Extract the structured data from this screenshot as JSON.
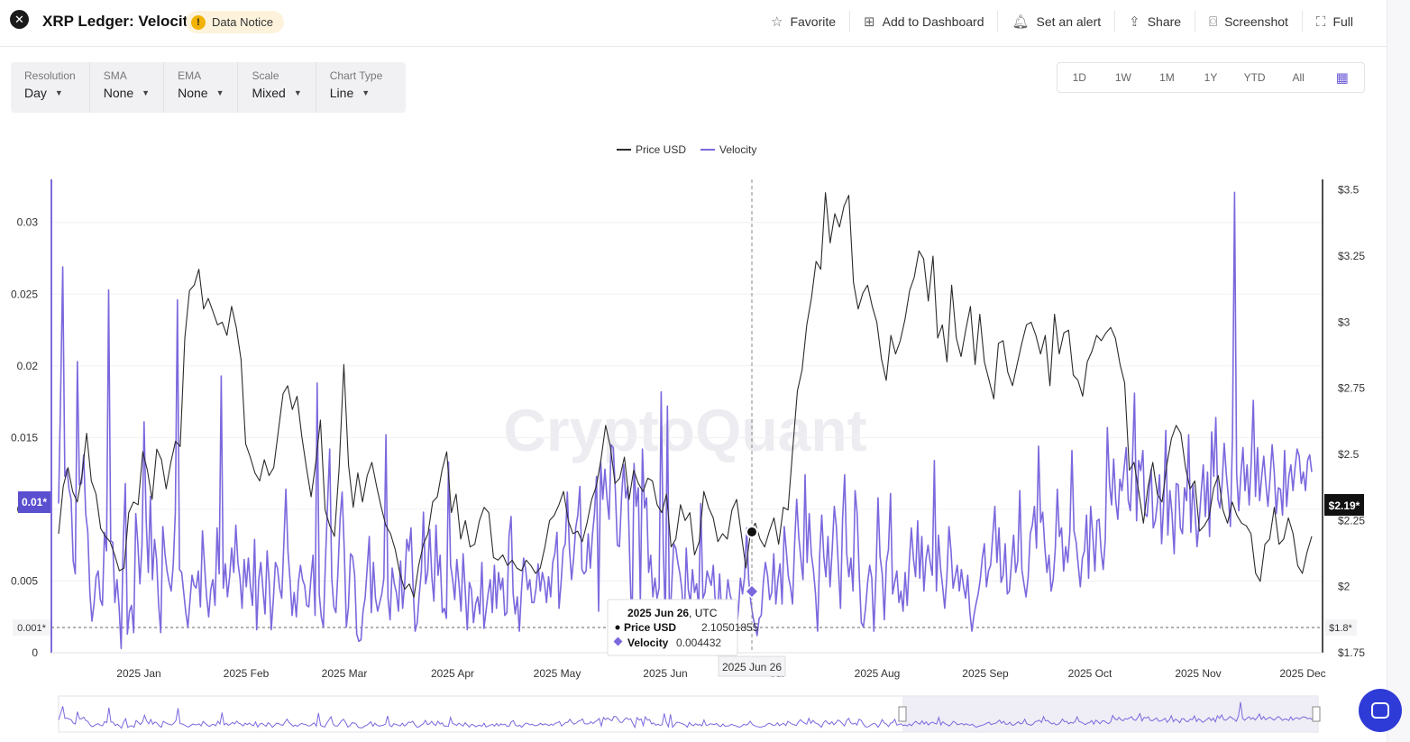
{
  "header": {
    "close_label": "✕",
    "title": "XRP Ledger: Velocity",
    "notice_icon": "!",
    "notice_label": "Data Notice",
    "actions": [
      {
        "label": "Favorite",
        "icon": "star-icon",
        "glyph": "☆"
      },
      {
        "label": "Add to Dashboard",
        "icon": "dashboard-add-icon",
        "glyph": "⊞"
      },
      {
        "label": "Set an alert",
        "icon": "bell-icon",
        "glyph": "🔔︎"
      },
      {
        "label": "Share",
        "icon": "share-icon",
        "glyph": "⇪"
      },
      {
        "label": "Screenshot",
        "icon": "camera-icon",
        "glyph": "⌼"
      },
      {
        "label": "Full",
        "icon": "fullscreen-icon",
        "glyph": "⛶"
      }
    ]
  },
  "toolbar": [
    {
      "label": "Resolution",
      "value": "Day"
    },
    {
      "label": "SMA",
      "value": "None"
    },
    {
      "label": "EMA",
      "value": "None"
    },
    {
      "label": "Scale",
      "value": "Mixed"
    },
    {
      "label": "Chart Type",
      "value": "Line"
    }
  ],
  "ranges": [
    "1D",
    "1W",
    "1M",
    "1Y",
    "YTD",
    "All"
  ],
  "calendar_icon": "calendar-icon",
  "colors": {
    "price": "#2b2b2b",
    "velocity": "#7b68dd",
    "accent": "#5a4fcf"
  },
  "watermark": "CryptoQuant",
  "tooltip": {
    "date": "2025 Jun 26",
    "date_suffix": ", UTC",
    "price_label": "Price USD",
    "price_value": "2.10501855",
    "velocity_label": "Velocity",
    "velocity_value": "0.004432"
  },
  "crosshair_label": "2025 Jun 26",
  "left_badge": "0.01*",
  "left_min_label": "0.001*",
  "right_badge": "$2.19*",
  "right_min_label": "$1.8*",
  "chart_data": {
    "type": "line",
    "legend": [
      "Price USD",
      "Velocity"
    ],
    "legend_position": "top-center",
    "x_ticks": [
      "2025 Jan",
      "2025 Feb",
      "2025 Mar",
      "2025 Apr",
      "2025 May",
      "2025 Jun",
      "Jul",
      "2025 Aug",
      "2025 Sep",
      "2025 Oct",
      "2025 Nov",
      "2025 Dec"
    ],
    "y_left_ticks": [
      "0",
      "0.005",
      "0.01",
      "0.015",
      "0.02",
      "0.025",
      "0.03"
    ],
    "y_left_range": [
      0,
      0.033
    ],
    "y_right_ticks": [
      "$1.75",
      "$2",
      "$2.25",
      "$2.5",
      "$2.75",
      "$3",
      "$3.25",
      "$3.5"
    ],
    "y_right_range": [
      1.75,
      3.54
    ],
    "grid": true,
    "series": [
      {
        "name": "Price USD",
        "axis": "right",
        "values": [
          2.2,
          2.38,
          2.45,
          2.36,
          2.32,
          2.42,
          2.58,
          2.4,
          2.35,
          2.22,
          2.19,
          2.17,
          2.12,
          2.06,
          2.07,
          2.28,
          2.32,
          2.31,
          2.51,
          2.44,
          2.33,
          2.52,
          2.48,
          2.37,
          2.47,
          2.55,
          2.53,
          2.94,
          3.12,
          3.14,
          3.2,
          3.05,
          3.09,
          3.04,
          2.99,
          3,
          2.95,
          3.06,
          2.98,
          2.86,
          2.54,
          2.49,
          2.43,
          2.4,
          2.48,
          2.42,
          2.45,
          2.59,
          2.73,
          2.76,
          2.67,
          2.72,
          2.57,
          2.45,
          2.34,
          2.47,
          2.63,
          2.29,
          2.23,
          2.19,
          2.45,
          2.84,
          2.46,
          2.3,
          2.43,
          2.32,
          2.42,
          2.47,
          2.38,
          2.3,
          2.23,
          2.2,
          2.14,
          2.05,
          1.99,
          2.01,
          1.96,
          2.08,
          2.16,
          2.2,
          2.32,
          2.34,
          2.44,
          2.51,
          2.28,
          2.35,
          2.18,
          2.25,
          2.15,
          2.16,
          2.25,
          2.3,
          2.28,
          2.11,
          2.1,
          2.12,
          2.08,
          2.1,
          2.07,
          2.06,
          2.1,
          2.08,
          2.05,
          2.07,
          2.15,
          2.25,
          2.27,
          2.31,
          2.36,
          2.25,
          2.2,
          2.21,
          2.17,
          2.24,
          2.33,
          2.38,
          2.48,
          2.61,
          2.53,
          2.39,
          2.41,
          2.49,
          2.33,
          2.44,
          2.39,
          2.36,
          2.41,
          2.4,
          2.31,
          2.28,
          2.35,
          2.15,
          2.18,
          2.31,
          2.25,
          2.28,
          2.12,
          2.17,
          2.36,
          2.3,
          2.26,
          2.17,
          2.2,
          2.18,
          2.29,
          2.33,
          2.2,
          2.07,
          2.21,
          2.24,
          2.18,
          2.15,
          2.21,
          2.26,
          2.16,
          2.3,
          2.29,
          2.52,
          2.74,
          2.82,
          2.99,
          3.09,
          3.23,
          3.2,
          3.49,
          3.3,
          3.41,
          3.36,
          3.44,
          3.48,
          3.15,
          3.05,
          3.11,
          3.14,
          3.06,
          3,
          2.86,
          2.78,
          2.95,
          2.88,
          2.93,
          3.01,
          3.12,
          3.17,
          3.27,
          3.24,
          3.08,
          3.25,
          2.94,
          2.99,
          2.85,
          3.14,
          2.94,
          2.87,
          2.97,
          3.06,
          2.84,
          3.03,
          2.85,
          2.78,
          2.71,
          2.92,
          2.93,
          2.81,
          2.76,
          2.84,
          2.92,
          2.99,
          3,
          2.95,
          2.88,
          2.95,
          2.76,
          3.03,
          2.88,
          2.96,
          2.97,
          2.8,
          2.78,
          2.72,
          2.85,
          2.89,
          2.95,
          2.93,
          2.96,
          2.98,
          2.94,
          2.84,
          2.77,
          2.44,
          2.47,
          2.36,
          2.24,
          2.38,
          2.47,
          2.35,
          2.32,
          2.46,
          2.56,
          2.61,
          2.58,
          2.45,
          2.37,
          2.4,
          2.21,
          2.23,
          2.26,
          2.37,
          2.42,
          2.29,
          2.24,
          2.32,
          2.27,
          2.24,
          2.23,
          2.2,
          2.05,
          2.02,
          2.16,
          2.18,
          2.3,
          2.16,
          2.18,
          2.26,
          2.2,
          2.08,
          2.05,
          2.13,
          2.19
        ]
      },
      {
        "name": "Velocity",
        "axis": "left",
        "values": [
          0.0104,
          0.0182,
          0.0269,
          0.0123,
          0.0128,
          0.0114,
          0.0107,
          0.0064,
          0.0055,
          0.0203,
          0.0117,
          0.0118,
          0.0138,
          0.0097,
          0.0084,
          0.0042,
          0.0022,
          0.0034,
          0.0053,
          0.0057,
          0.0037,
          0.0033,
          0.0084,
          0.0071,
          0.0253,
          0.0078,
          0.0077,
          0.0035,
          0.0051,
          0.0032,
          0.0003,
          0.0077,
          0.0118,
          0.0013,
          0.0029,
          0.0033,
          0.0014,
          0.0097,
          0.0076,
          0.0048,
          0.0075,
          0.0161,
          0.0093,
          0.0056,
          0.0109,
          0.0051,
          0.0079,
          0.0065,
          0.0033,
          0.0014,
          0.0088,
          0.0069,
          0.0057,
          0.0049,
          0.0043,
          0.0062,
          0.0098,
          0.0246,
          0.0058,
          0.0056,
          0.0042,
          0.0028,
          0.0018,
          0.0036,
          0.0054,
          0.0047,
          0.0045,
          0.0057,
          0.0032,
          0.0085,
          0.0061,
          0.0039,
          0.0025,
          0.0044,
          0.0051,
          0.0033,
          0.0087,
          0.0055,
          0.0193,
          0.0045,
          0.0062,
          0.0039,
          0.0053,
          0.0073,
          0.0056,
          0.0089,
          0.0063,
          0.0052,
          0.0031,
          0.0065,
          0.0046,
          0.0066,
          0.0046,
          0.0033,
          0.0079,
          0.0016,
          0.0051,
          0.0063,
          0.0044,
          0.0027,
          0.0071,
          0.0049,
          0.0016,
          0.0037,
          0.0063,
          0.0059,
          0.0045,
          0.0038,
          0.0075,
          0.0114,
          0.0071,
          0.0051,
          0.0026,
          0.0042,
          0.0025,
          0.0049,
          0.0061,
          0.0051,
          0.0047,
          0.0033,
          0.0032,
          0.0052,
          0.0068,
          0.0026,
          0.0188,
          0.0041,
          0.0025,
          0.0018,
          0.0064,
          0.0105,
          0.0142,
          0.0052,
          0.0032,
          0.0028,
          0.0057,
          0.0093,
          0.0112,
          0.0071,
          0.0018,
          0.0032,
          0.0069,
          0.0067,
          0.0054,
          0.0013,
          0.0008,
          0.0009,
          0.0029,
          0.0038,
          0.0059,
          0.0081,
          0.0028,
          0.0063,
          0.0038,
          0.0029,
          0.0035,
          0.0041,
          0.0052,
          0.0152,
          0.0038,
          0.0023,
          0.0059,
          0.0048,
          0.0042,
          0.0029,
          0.0064,
          0.0031,
          0.0048,
          0.0079,
          0.0071,
          0.0087,
          0.0046,
          0.0015,
          0.0021,
          0.0041,
          0.0057,
          0.0098,
          0.0048,
          0.0056,
          0.0086,
          0.0053,
          0.0036,
          0.0089,
          0.0054,
          0.0068,
          0.0028,
          0.0031,
          0.0024,
          0.0133,
          0.0061,
          0.0051,
          0.0037,
          0.0065,
          0.0048,
          0.0029,
          0.0069,
          0.0044,
          0.0016,
          0.0049,
          0.0044,
          0.0021,
          0.0034,
          0.0039,
          0.0027,
          0.0063,
          0.0017,
          0.0029,
          0.0041,
          0.0051,
          0.0028,
          0.0061,
          0.0031,
          0.0056,
          0.0044,
          0.0052,
          0.0026,
          0.0028,
          0.0081,
          0.0095,
          0.0041,
          0.0027,
          0.0039,
          0.0015,
          0.0043,
          0.0066,
          0.0058,
          0.0044,
          0.0051,
          0.0035,
          0.0035,
          0.0045,
          0.0062,
          0.0043,
          0.0056,
          0.0049,
          0.0035,
          0.0053,
          0.0039,
          0.0063,
          0.0069,
          0.0084,
          0.0031,
          0.0049,
          0.0072,
          0.0076,
          0.0112,
          0.0073,
          0.0051,
          0.0066,
          0.0087,
          0.0096,
          0.0116,
          0.0058,
          0.0055,
          0.0057,
          0.0083,
          0.0059,
          0.0082,
          0.0097,
          0.0123,
          0.0029,
          0.0133,
          0.0107,
          0.0128,
          0.0108,
          0.0093,
          0.0145,
          0.0143,
          0.0114,
          0.0075,
          0.0074,
          0.0109,
          0.0131,
          0.0108,
          0.0116,
          0.0061,
          0.0013,
          0.0132,
          0.0102,
          0.0115,
          0.0035,
          0.0142,
          0.0101,
          0.0108,
          0.0056,
          0.0068,
          0.0039,
          0.0052,
          0.0038,
          0.0045,
          0.0182,
          0.0074,
          0.0021,
          0.0172,
          0.0015,
          0.0046,
          0.0076,
          0.0073,
          0.0063,
          0.0055,
          0.0043,
          0.0015,
          0.0073,
          0.0044,
          0.0035,
          0.0058,
          0.0042,
          0.0048,
          0.0031,
          0.0104,
          0.0038,
          0.0042,
          0.0057,
          0.0052,
          0.0047,
          0.0061,
          0.0034,
          0.0024,
          0.0055,
          0.0027,
          0.0029,
          0.0033,
          0.0051,
          0.0041,
          0.0035,
          0.0022,
          0.0016,
          0.0029,
          0.0052,
          0.0041,
          0.0053,
          0.0087,
          0.0051,
          0.0035,
          0.0025,
          0.0019,
          0.0012,
          0.0024,
          0.0026,
          0.0049,
          0.0063,
          0.0054,
          0.0037,
          0.0042,
          0.0069,
          0.0034,
          0.0051,
          0.0062,
          0.0034,
          0.0088,
          0.0071,
          0.0053,
          0.0046,
          0.0034,
          0.0076,
          0.0107,
          0.0081,
          0.0065,
          0.0051,
          0.0124,
          0.0063,
          0.0097,
          0.0069,
          0.0058,
          0.0041,
          0.0015,
          0.0068,
          0.0096,
          0.0067,
          0.0053,
          0.0081,
          0.0046,
          0.0072,
          0.0102,
          0.0088,
          0.0059,
          0.0031,
          0.0093,
          0.0124,
          0.0069,
          0.0053,
          0.0066,
          0.0043,
          0.0113,
          0.0097,
          0.0054,
          0.0021,
          0.0018,
          0.0031,
          0.0049,
          0.0061,
          0.0052,
          0.0015,
          0.0053,
          0.0108,
          0.0067,
          0.0055,
          0.0023,
          0.0063,
          0.0072,
          0.0111,
          0.0041,
          0.0049,
          0.0057,
          0.0035,
          0.0043,
          0.0029,
          0.0056,
          0.0033,
          0.0063,
          0.0087,
          0.0065,
          0.0053,
          0.0092,
          0.0052,
          0.0081,
          0.0043,
          0.0065,
          0.0075,
          0.0063,
          0.0054,
          0.0134,
          0.0043,
          0.0082,
          0.0059,
          0.0046,
          0.0031,
          0.0053,
          0.0088,
          0.0071,
          0.0045,
          0.0053,
          0.0061,
          0.0043,
          0.0058,
          0.0046,
          0.0038,
          0.0054,
          0.0029,
          0.0015,
          0.0026,
          0.0034,
          0.0041,
          0.0051,
          0.0066,
          0.0076,
          0.0046,
          0.0057,
          0.0061,
          0.0081,
          0.0102,
          0.0063,
          0.0087,
          0.0049,
          0.0054,
          0.0076,
          0.0041,
          0.0043,
          0.0063,
          0.0082,
          0.0056,
          0.0064,
          0.0113,
          0.0058,
          0.0048,
          0.0039,
          0.0053,
          0.0083,
          0.0089,
          0.0102,
          0.0073,
          0.0144,
          0.0091,
          0.0098,
          0.0073,
          0.0056,
          0.0068,
          0.0043,
          0.0051,
          0.0072,
          0.0114,
          0.0081,
          0.0087,
          0.0057,
          0.0074,
          0.0063,
          0.0084,
          0.0141,
          0.0085,
          0.0077,
          0.0061,
          0.0046,
          0.0066,
          0.0071,
          0.0096,
          0.0052,
          0.0102,
          0.0081,
          0.0057,
          0.0092,
          0.0093,
          0.0071,
          0.0058,
          0.0079,
          0.0157,
          0.0118,
          0.0103,
          0.0135,
          0.0106,
          0.0093,
          0.0121,
          0.0113,
          0.0128,
          0.0143,
          0.0106,
          0.0099,
          0.0133,
          0.0181,
          0.0092,
          0.0134,
          0.0127,
          0.0141,
          0.0097,
          0.0095,
          0.0113,
          0.0128,
          0.0087,
          0.0092,
          0.0105,
          0.0124,
          0.0076,
          0.0104,
          0.0155,
          0.0082,
          0.0113,
          0.0097,
          0.0069,
          0.0118,
          0.0117,
          0.0087,
          0.0083,
          0.0115,
          0.0106,
          0.0152,
          0.0084,
          0.0118,
          0.0099,
          0.0074,
          0.0091,
          0.0112,
          0.0131,
          0.0095,
          0.0126,
          0.0081,
          0.0154,
          0.0123,
          0.0164,
          0.0107,
          0.0101,
          0.0117,
          0.0146,
          0.0125,
          0.0109,
          0.0088,
          0.0151,
          0.0321,
          0.0125,
          0.0099,
          0.0124,
          0.0143,
          0.0113,
          0.0131,
          0.0103,
          0.0133,
          0.0176,
          0.0109,
          0.0143,
          0.0106,
          0.0123,
          0.0137,
          0.0118,
          0.0102,
          0.0121,
          0.0145,
          0.0126,
          0.0097,
          0.0115,
          0.0114,
          0.0096,
          0.0141,
          0.0102,
          0.0123,
          0.0131,
          0.0113,
          0.0129,
          0.0142,
          0.0137,
          0.0118,
          0.0126,
          0.0113,
          0.0134,
          0.0138,
          0.0126
        ]
      }
    ]
  }
}
